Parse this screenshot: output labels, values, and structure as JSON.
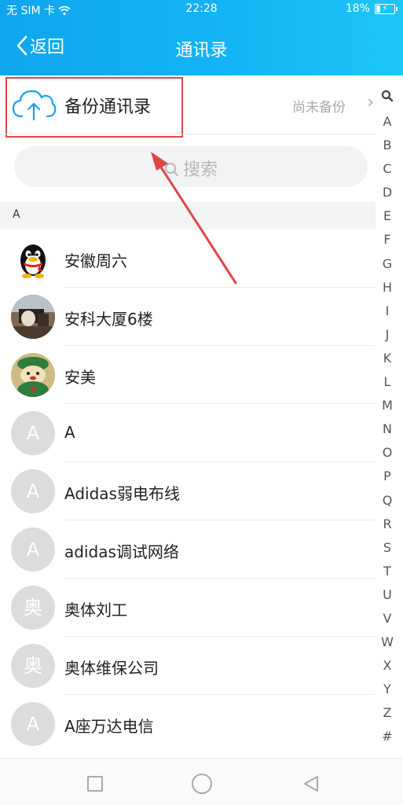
{
  "status_bar": {
    "carrier": "无 SIM 卡",
    "time": "22:28",
    "battery": "18%"
  },
  "header": {
    "back_label": "返回",
    "title": "通讯录"
  },
  "backup": {
    "label": "备份通讯录",
    "status": "尚未备份"
  },
  "search": {
    "placeholder": "搜索"
  },
  "section": {
    "letter": "A"
  },
  "contacts": [
    {
      "name": "安徽周六",
      "avatar_text": ""
    },
    {
      "name": "安科大厦6楼",
      "avatar_text": ""
    },
    {
      "name": "安美",
      "avatar_text": ""
    },
    {
      "name": "A",
      "avatar_text": "A"
    },
    {
      "name": "Adidas弱电布线",
      "avatar_text": "A"
    },
    {
      "name": "adidas调试网络",
      "avatar_text": "A"
    },
    {
      "name": "奥体刘工",
      "avatar_text": "奥"
    },
    {
      "name": "奥体维保公司",
      "avatar_text": "奥"
    },
    {
      "name": "A座万达电信",
      "avatar_text": "A"
    }
  ],
  "index_letters": [
    "A",
    "B",
    "C",
    "D",
    "E",
    "F",
    "G",
    "H",
    "I",
    "J",
    "K",
    "L",
    "M",
    "N",
    "O",
    "P",
    "Q",
    "R",
    "S",
    "T",
    "U",
    "V",
    "W",
    "X",
    "Y",
    "Z",
    "#"
  ],
  "colors": {
    "header_start": "#0fa6ee",
    "header_end": "#1cc6f8",
    "highlight_box": "#e04747",
    "annotation_arrow": "#e04747",
    "cloud_icon": "#1aa3ea"
  }
}
